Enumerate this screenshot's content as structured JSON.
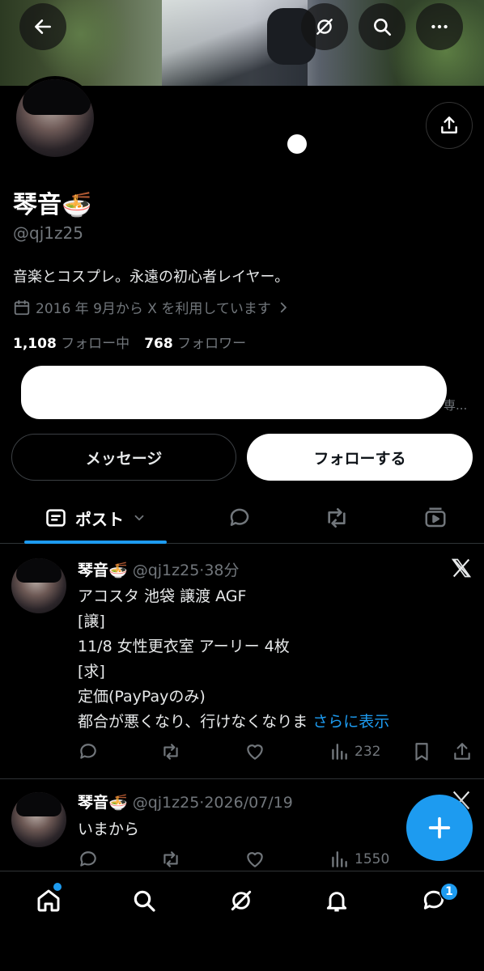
{
  "profile": {
    "name": "琴音🍜",
    "handle": "@qj1z25",
    "bio": "音楽とコスプレ。永遠の初心者レイヤー。",
    "joined": "2016 年 9月から X を利用しています",
    "following_count": "1,108",
    "following_label": "フォロー中",
    "followers_count": "768",
    "followers_label": "フォロワー",
    "truncated_text": "専..."
  },
  "buttons": {
    "message": "メッセージ",
    "follow": "フォローする"
  },
  "tabs": {
    "posts": "ポスト"
  },
  "tweets": [
    {
      "name": "琴音🍜",
      "handle": "@qj1z25",
      "time": "·38分",
      "lines": [
        "アコスタ 池袋 譲渡 AGF",
        "[譲]",
        "11/8 女性更衣室 アーリー 4枚",
        "[求]",
        "定価(PayPayのみ)",
        "都合が悪くなり、行けなくなりま"
      ],
      "more": "さらに表示",
      "views": "232"
    },
    {
      "name": "琴音🍜",
      "handle": "@qj1z25",
      "time": "·2026/07/19",
      "lines": [
        "いまから"
      ],
      "views": "1550"
    }
  ],
  "nav": {
    "messages_badge": "1"
  },
  "colors": {
    "accent": "#1d9bf0",
    "background": "#000000",
    "muted": "#71767b"
  }
}
